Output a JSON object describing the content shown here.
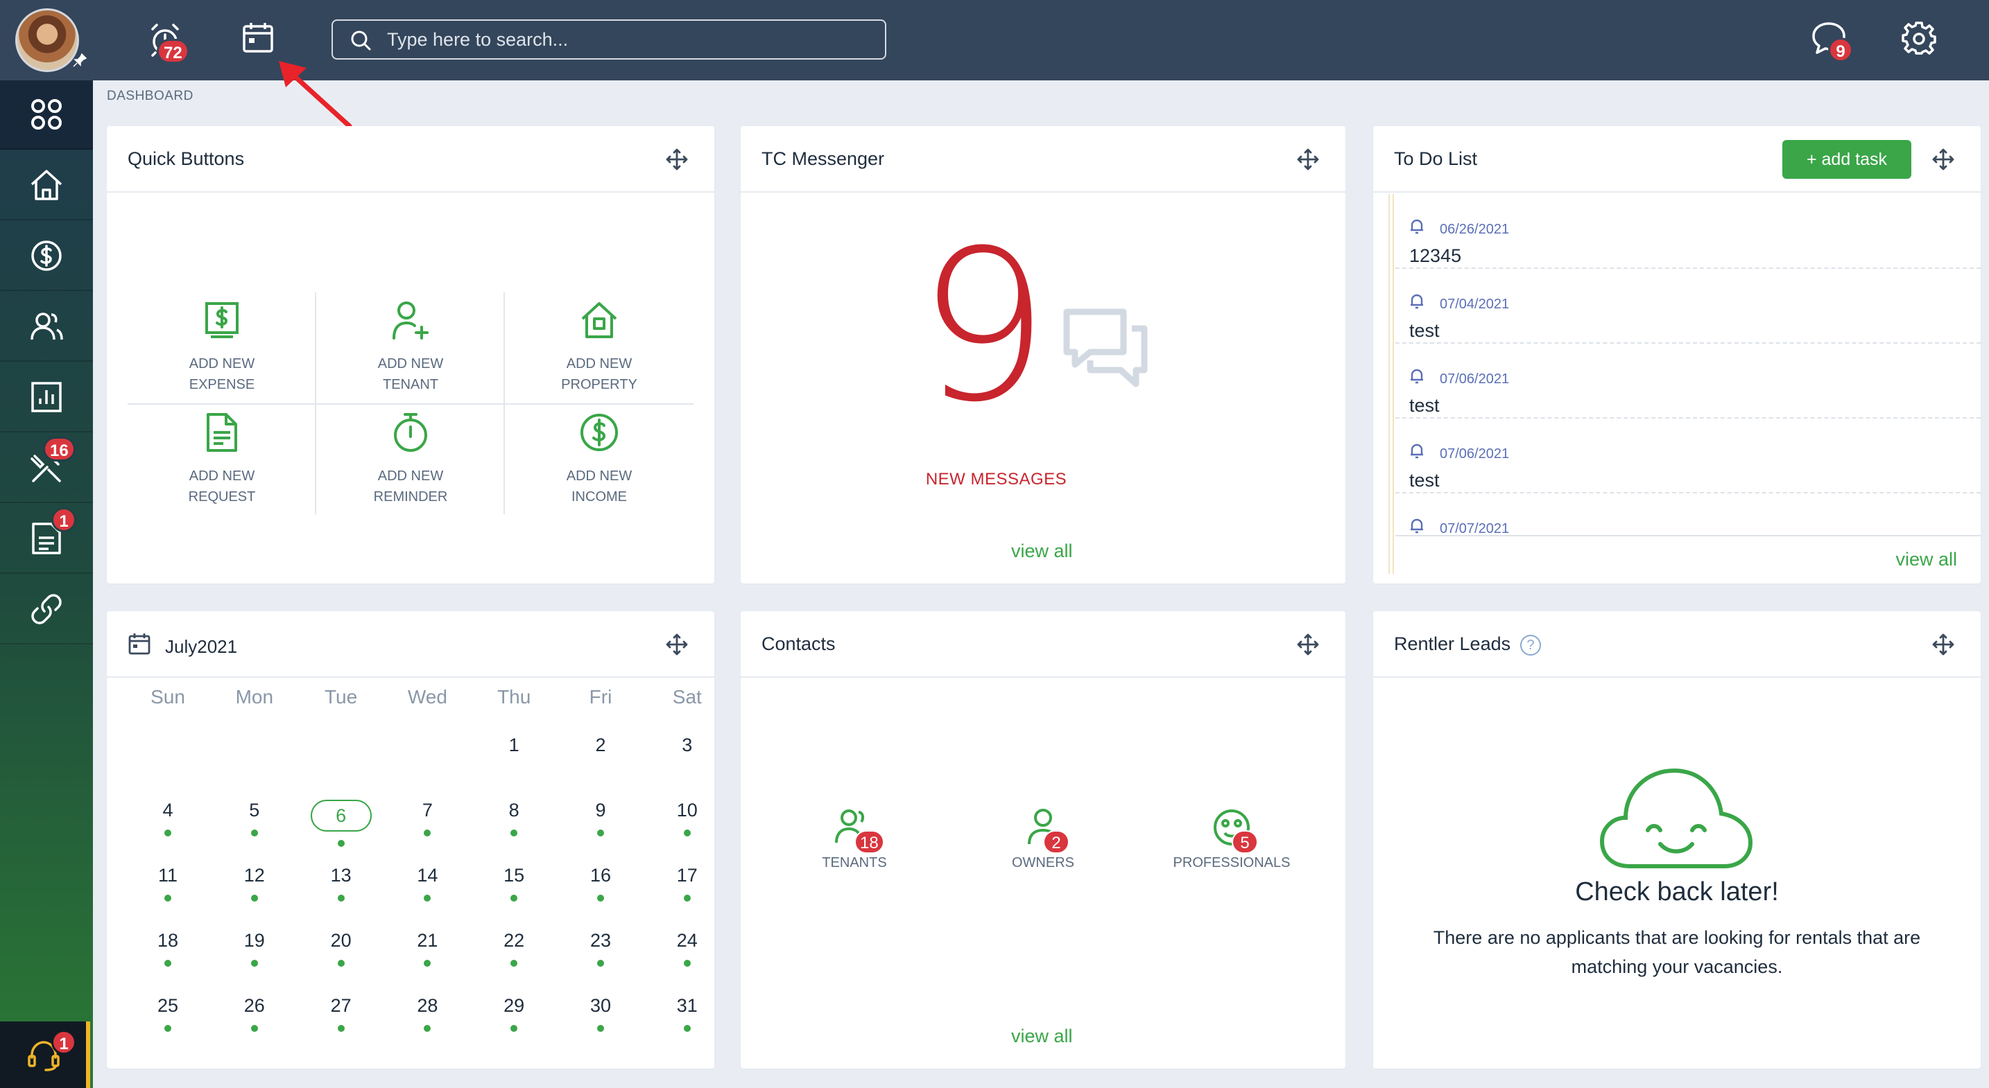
{
  "topbar": {
    "alarm_badge": "72",
    "search_placeholder": "Type here to search...",
    "messages_badge": "9"
  },
  "sidebar": {
    "items": [
      {
        "icon": "dashboard-grid-icon",
        "active": true
      },
      {
        "icon": "home-icon"
      },
      {
        "icon": "dollar-icon"
      },
      {
        "icon": "people-icon"
      },
      {
        "icon": "reports-icon"
      },
      {
        "icon": "tools-icon",
        "badge": "16"
      },
      {
        "icon": "document-icon",
        "badge": "1"
      },
      {
        "icon": "link-icon"
      }
    ],
    "help_badge": "1"
  },
  "breadcrumb": "DASHBOARD",
  "quick_buttons": {
    "title": "Quick Buttons",
    "items": [
      {
        "line1": "ADD NEW",
        "line2": "EXPENSE",
        "icon": "expense-icon"
      },
      {
        "line1": "ADD NEW",
        "line2": "TENANT",
        "icon": "add-user-icon"
      },
      {
        "line1": "ADD NEW",
        "line2": "PROPERTY",
        "icon": "property-icon"
      },
      {
        "line1": "ADD NEW",
        "line2": "REQUEST",
        "icon": "request-icon"
      },
      {
        "line1": "ADD NEW",
        "line2": "REMINDER",
        "icon": "stopwatch-icon"
      },
      {
        "line1": "ADD NEW",
        "line2": "INCOME",
        "icon": "income-icon"
      }
    ]
  },
  "messenger": {
    "title": "TC Messenger",
    "count": "9",
    "label": "NEW MESSAGES",
    "view_all": "view all"
  },
  "todo": {
    "title": "To Do List",
    "add_task": "+ add task",
    "items": [
      {
        "date": "06/26/2021",
        "text": "12345"
      },
      {
        "date": "07/04/2021",
        "text": "test"
      },
      {
        "date": "07/06/2021",
        "text": "test"
      },
      {
        "date": "07/06/2021",
        "text": "test"
      },
      {
        "date": "07/07/2021",
        "text": ""
      }
    ],
    "view_all": "view all"
  },
  "calendar": {
    "title": "July2021",
    "weekdays": [
      "Sun",
      "Mon",
      "Tue",
      "Wed",
      "Thu",
      "Fri",
      "Sat"
    ],
    "weeks": [
      [
        "",
        "",
        "",
        "",
        "1",
        "2",
        "3"
      ],
      [
        "4",
        "5",
        "6",
        "7",
        "8",
        "9",
        "10"
      ],
      [
        "11",
        "12",
        "13",
        "14",
        "15",
        "16",
        "17"
      ],
      [
        "18",
        "19",
        "20",
        "21",
        "22",
        "23",
        "24"
      ],
      [
        "25",
        "26",
        "27",
        "28",
        "29",
        "30",
        "31"
      ]
    ],
    "today": "6",
    "accent_color": "#3aa648"
  },
  "contacts": {
    "title": "Contacts",
    "items": [
      {
        "label": "TENANTS",
        "count": "18",
        "icon": "tenants-icon"
      },
      {
        "label": "OWNERS",
        "count": "2",
        "icon": "owner-icon"
      },
      {
        "label": "PROFESSIONALS",
        "count": "5",
        "icon": "professionals-icon"
      }
    ],
    "view_all": "view all"
  },
  "rentler": {
    "title": "Rentler Leads",
    "heading": "Check back later!",
    "description": "There are no applicants that are looking for rentals that are matching your vacancies."
  },
  "colors": {
    "topbar": "#34465c",
    "green": "#3aa648",
    "red": "#c8252d",
    "badge_red": "#d9363e"
  }
}
